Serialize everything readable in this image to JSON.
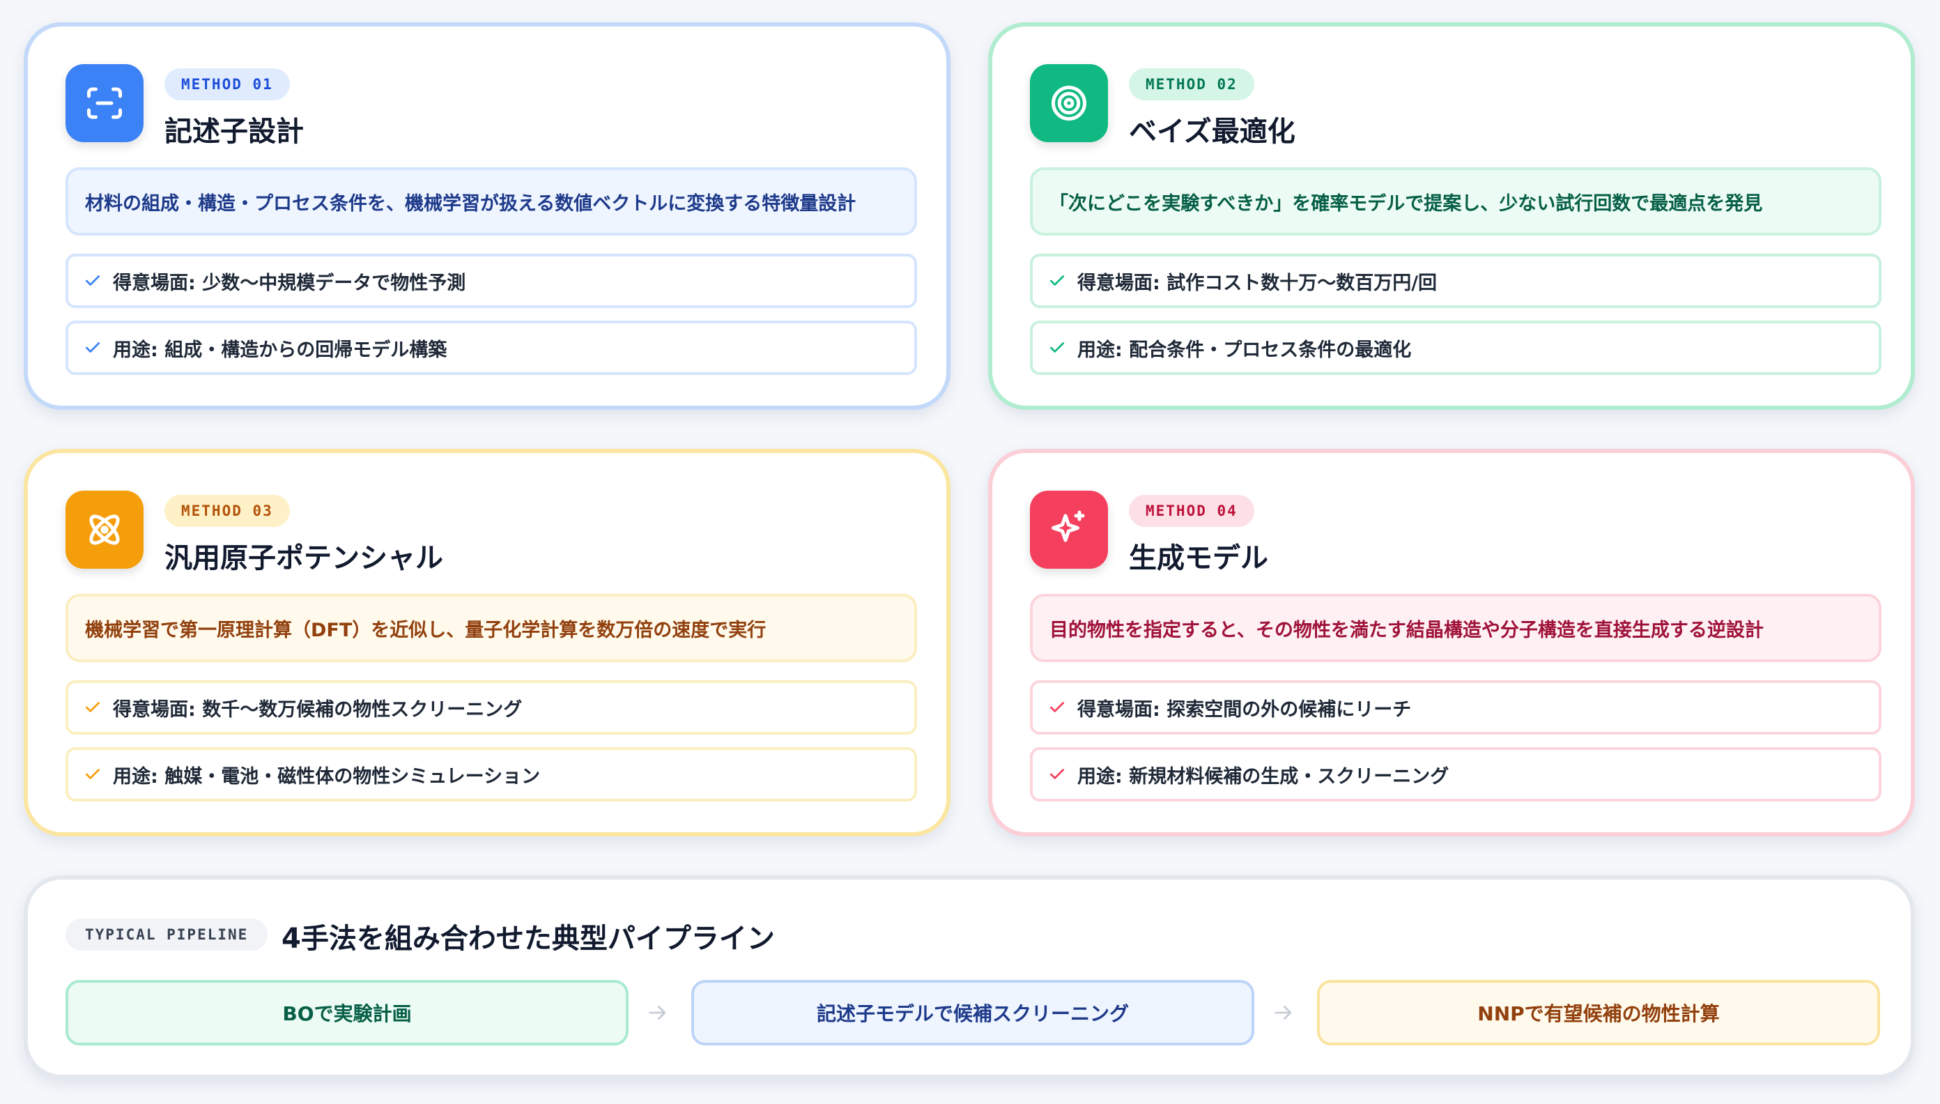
{
  "methods": [
    {
      "badge": "METHOD 01",
      "title": "記述子設計",
      "icon": "scan-icon",
      "description": "材料の組成・構造・プロセス条件を、機械学習が扱える数値ベクトルに変換する特徴量設計",
      "strength": "得意場面: 少数〜中規模データで物性予測",
      "use": "用途: 組成・構造からの回帰モデル構築",
      "accent": "#3b82f6"
    },
    {
      "badge": "METHOD 02",
      "title": "ベイズ最適化",
      "icon": "target-icon",
      "description": "「次にどこを実験すべきか」を確率モデルで提案し、少ない試行回数で最適点を発見",
      "strength": "得意場面: 試作コスト数十万〜数百万円/回",
      "use": "用途: 配合条件・プロセス条件の最適化",
      "accent": "#10b981"
    },
    {
      "badge": "METHOD 03",
      "title": "汎用原子ポテンシャル",
      "icon": "atom-icon",
      "description": "機械学習で第一原理計算（DFT）を近似し、量子化学計算を数万倍の速度で実行",
      "strength": "得意場面: 数千〜数万候補の物性スクリーニング",
      "use": "用途: 触媒・電池・磁性体の物性シミュレーション",
      "accent": "#f59e0b"
    },
    {
      "badge": "METHOD 04",
      "title": "生成モデル",
      "icon": "sparkles-icon",
      "description": "目的物性を指定すると、その物性を満たす結晶構造や分子構造を直接生成する逆設計",
      "strength": "得意場面: 探索空間の外の候補にリーチ",
      "use": "用途: 新規材料候補の生成・スクリーニング",
      "accent": "#f43f5e"
    }
  ],
  "pipeline": {
    "badge": "TYPICAL PIPELINE",
    "title": "4手法を組み合わせた典型パイプライン",
    "steps": [
      "BOで実験計画",
      "記述子モデルで候補スクリーニング",
      "NNPで有望候補の物性計算"
    ]
  }
}
